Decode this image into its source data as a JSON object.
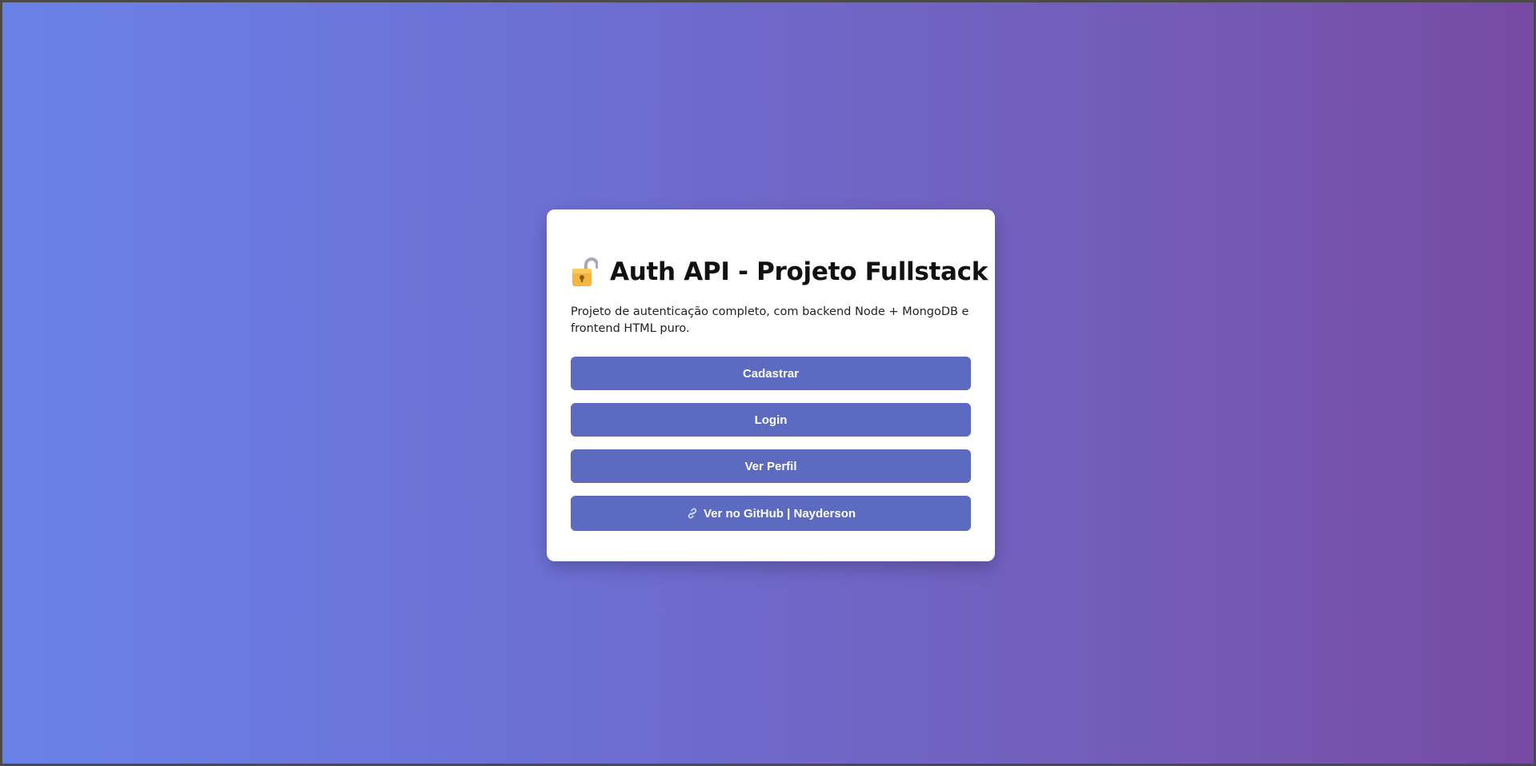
{
  "card": {
    "title": "Auth API - Projeto Fullstack",
    "title_icon": "lock-icon",
    "description": "Projeto de autenticação completo, com backend Node + MongoDB e frontend HTML puro."
  },
  "buttons": {
    "register_label": "Cadastrar",
    "login_label": "Login",
    "profile_label": "Ver Perfil",
    "github_label": "Ver no GitHub | Nayderson",
    "github_icon": "link-icon"
  },
  "colors": {
    "background_gradient_start": "#6a82e8",
    "background_gradient_end": "#774aa3",
    "button": "#5c6bc0",
    "button_text": "#ffffff",
    "card": "#ffffff"
  }
}
